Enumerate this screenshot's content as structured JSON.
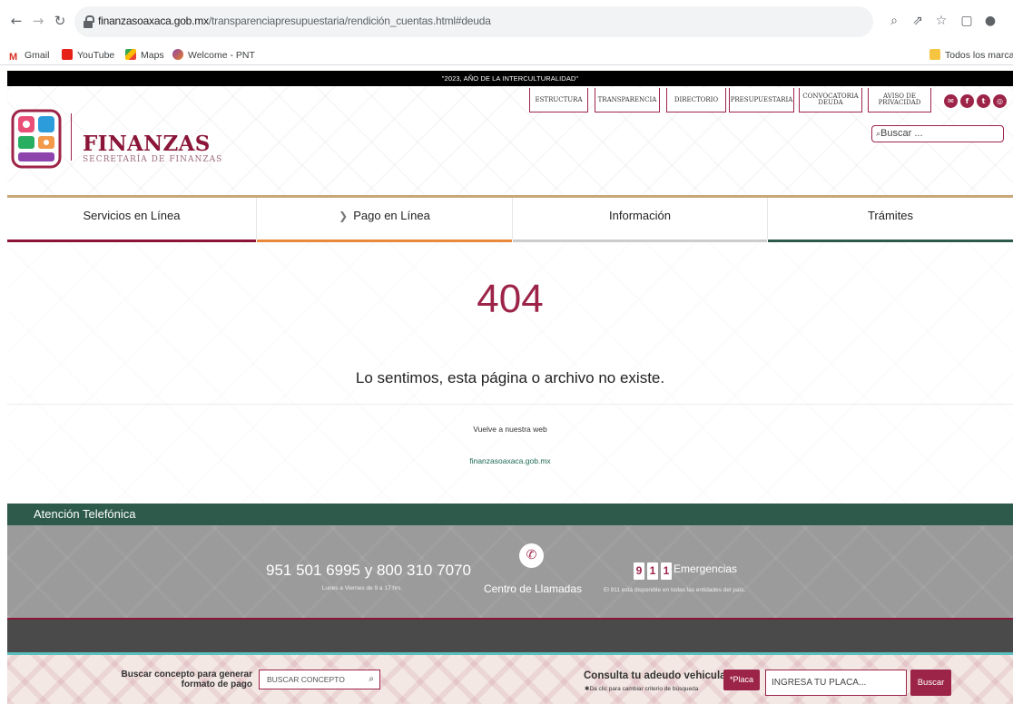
{
  "browser": {
    "url_domain": "finanzasoaxaca.gob.mx",
    "url_path": "/transparenciapresupuestaria/rendición_cuentas.html#deuda",
    "bookmarks": [
      "Gmail",
      "YouTube",
      "Maps",
      "Welcome - PNT"
    ],
    "all_bookmarks": "Todos los marcado"
  },
  "site": {
    "year_banner": "\"2023, AÑO DE LA INTERCULTURALIDAD\"",
    "logo_title": "FINANZAS",
    "logo_subtitle": "SECRETARÍA DE FINANZAS",
    "top_links": [
      "ESTRUCTURA",
      "TRANSPARENCIA",
      "DIRECTORIO",
      "PRESUPUESTARIA",
      "CONVOCATORIA DEUDA",
      "AVISO DE PRIVACIDAD"
    ],
    "search_placeholder": "Buscar ...",
    "main_nav": [
      "Servicios en Línea",
      "Pago en Línea",
      "Información",
      "Trámites"
    ],
    "error_code": "404",
    "error_message": "Lo sentimos, esta página o archivo no existe.",
    "back_label": "Vuelve a nuestra web",
    "back_link": "finanzasoaxaca.gob.mx",
    "phone_section": {
      "title": "Atención Telefónica",
      "numbers": "951 501 6995 y 800 310 7070",
      "hours": "Lunes a Viernes de 9 a 17 hrs.",
      "call_center": "Centro de Llamadas",
      "emergency_digits": [
        "9",
        "1",
        "1"
      ],
      "emergency_label": "Emergencias",
      "emergency_note": "El 911 está disponible en todas las entidades del país."
    },
    "bottom": {
      "concept_label": "Buscar concepto para generar formato de pago",
      "concept_placeholder": "BUSCAR CONCEPTO",
      "vehicle_title": "Consulta tu adeudo vehicular",
      "vehicle_sub": "✱Da clic para cambiar criterio de búsqueda",
      "placa_button": "*Placa",
      "placa_placeholder": "INGRESA TU PLACA...",
      "buscar_button": "Buscar"
    }
  }
}
